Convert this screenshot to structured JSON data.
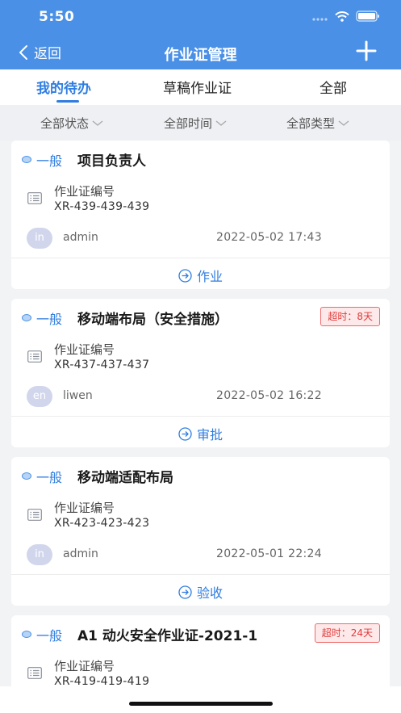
{
  "status_bar": {
    "time": "5:50"
  },
  "nav": {
    "back_label": "返回",
    "title": "作业证管理"
  },
  "tabs": [
    {
      "label": "我的待办",
      "active": true
    },
    {
      "label": "草稿作业证",
      "active": false
    },
    {
      "label": "全部",
      "active": false
    }
  ],
  "filters": [
    {
      "label": "全部状态"
    },
    {
      "label": "全部时间"
    },
    {
      "label": "全部类型"
    }
  ],
  "cards": [
    {
      "level": "一般",
      "title": "项目负责人",
      "overdue": "",
      "permit_label": "作业证编号",
      "permit_number": "XR-439-439-439",
      "avatar": "in",
      "user": "admin",
      "time": "2022-05-02 17:43",
      "action": "作业"
    },
    {
      "level": "一般",
      "title": "移动端布局（安全措施）",
      "overdue": "超时：8天",
      "permit_label": "作业证编号",
      "permit_number": "XR-437-437-437",
      "avatar": "en",
      "user": "liwen",
      "time": "2022-05-02 16:22",
      "action": "审批"
    },
    {
      "level": "一般",
      "title": "移动端适配布局",
      "overdue": "",
      "permit_label": "作业证编号",
      "permit_number": "XR-423-423-423",
      "avatar": "in",
      "user": "admin",
      "time": "2022-05-01 22:24",
      "action": "验收"
    },
    {
      "level": "一般",
      "title": "A1 动火安全作业证-2021-1",
      "overdue": "超时：24天",
      "permit_label": "作业证编号",
      "permit_number": "XR-419-419-419",
      "avatar": "",
      "user": "",
      "time": "",
      "action": ""
    }
  ],
  "colors": {
    "primary": "#4a90e6",
    "accent": "#2f7de1",
    "overdue": "#e23a3a"
  }
}
